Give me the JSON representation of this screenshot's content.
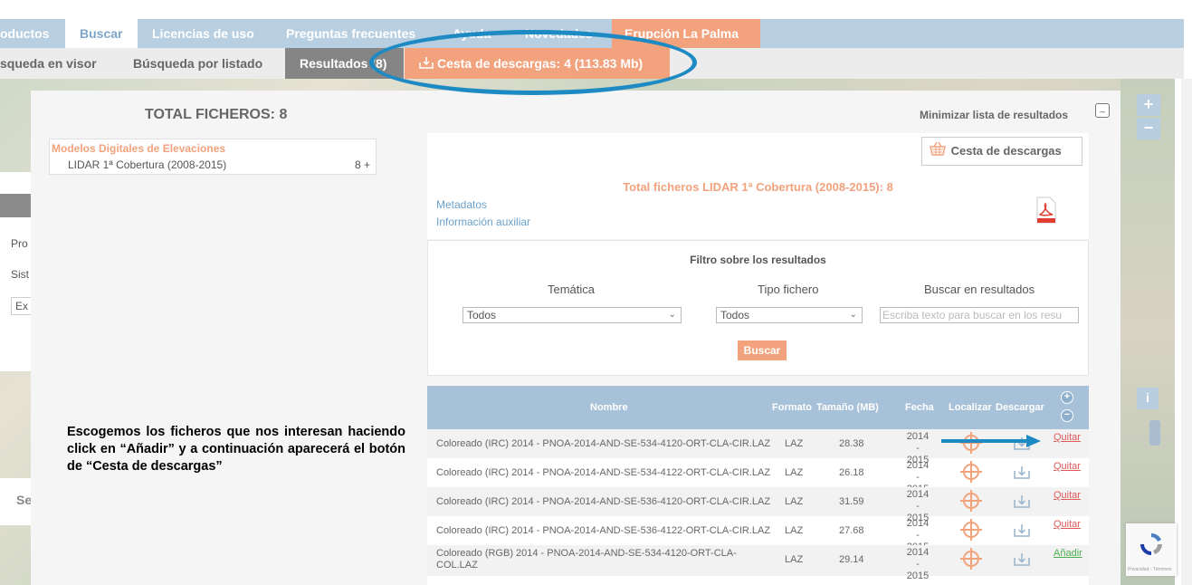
{
  "nav": {
    "tabs": [
      {
        "label": "oductos"
      },
      {
        "label": "Buscar"
      },
      {
        "label": "Licencias de uso"
      },
      {
        "label": "Preguntas frecuentes"
      },
      {
        "label": "Ayuda"
      },
      {
        "label": "Novedades"
      },
      {
        "label": "Erupción La Palma"
      }
    ],
    "active_tab": "Buscar"
  },
  "subnav": {
    "visor": "squeda en visor",
    "listado": "Búsqueda por listado",
    "resultados": "Resultados (8)",
    "cart": "Cesta de descargas: 4 (113.83 Mb)"
  },
  "left_panel": {
    "line1": "Pro",
    "line2": "Sist",
    "input": "Ex",
    "bottom": "Se"
  },
  "panel": {
    "total": "TOTAL FICHEROS: 8",
    "minimize": "Minimizar lista de resultados",
    "tree": {
      "category": "Modelos Digitales de Elevaciones",
      "item": "LIDAR 1ª Cobertura (2008-2015)",
      "count": "8 +"
    },
    "cesta_button": "Cesta de descargas",
    "total_line": "Total ficheros  LIDAR 1ª Cobertura (2008-2015): 8",
    "metadatos": "Metadatos",
    "info_aux": "Información auxiliar",
    "filter": {
      "title": "Filtro sobre los resultados",
      "tematica_label": "Temática",
      "tipo_label": "Tipo fichero",
      "buscar_label": "Buscar en resultados",
      "tematica_value": "Todos",
      "tipo_value": "Todos",
      "search_placeholder": "Escriba texto para buscar en los resu",
      "buscar_button": "Buscar"
    }
  },
  "table": {
    "headers": {
      "nombre": "Nombre",
      "formato": "Formato",
      "tamano": "Tamaño (MB)",
      "fecha": "Fecha",
      "localizar": "Localizar",
      "descargar": "Descargar"
    },
    "rows": [
      {
        "name": "Coloreado (IRC) 2014 - PNOA-2014-AND-SE-534-4120-ORT-CLA-CIR.LAZ",
        "format": "LAZ",
        "size": "28.38",
        "date1": "2014 -",
        "date2": "2015",
        "action": "Quitar"
      },
      {
        "name": "Coloreado (IRC) 2014 - PNOA-2014-AND-SE-534-4122-ORT-CLA-CIR.LAZ",
        "format": "LAZ",
        "size": "26.18",
        "date1": "2014 -",
        "date2": "2015",
        "action": "Quitar"
      },
      {
        "name": "Coloreado (IRC) 2014 - PNOA-2014-AND-SE-536-4120-ORT-CLA-CIR.LAZ",
        "format": "LAZ",
        "size": "31.59",
        "date1": "2014 -",
        "date2": "2015",
        "action": "Quitar"
      },
      {
        "name": "Coloreado (IRC) 2014 - PNOA-2014-AND-SE-536-4122-ORT-CLA-CIR.LAZ",
        "format": "LAZ",
        "size": "27.68",
        "date1": "2014 -",
        "date2": "2015",
        "action": "Quitar"
      },
      {
        "name1": "Coloreado (RGB) 2014 - PNOA-2014-AND-SE-534-4120-ORT-CLA-",
        "name2": "COL.LAZ",
        "format": "LAZ",
        "size": "29.14",
        "date1": "2014 -",
        "date2": "2015",
        "action": "Añadir"
      }
    ]
  },
  "instructions": "Escogemos los ficheros que nos interesan haciendo click en “Añadir” y a continuación aparecerá el botón de “Cesta de descargas”",
  "map_controls": {
    "zoom_in": "+",
    "zoom_out": "−",
    "info": "i"
  },
  "recaptcha": "Privacidad - Términos",
  "colors": {
    "accent": "#f2a27d",
    "nav_blue": "#b8cfe1",
    "annotation_blue": "#1e8ac3",
    "link": "#6aa0c9"
  }
}
